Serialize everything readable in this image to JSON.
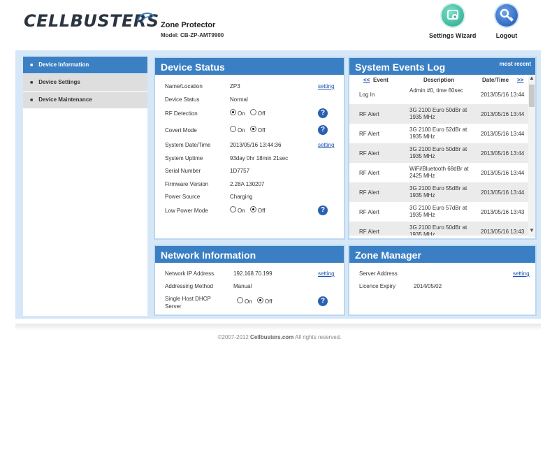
{
  "header": {
    "logo_text": "CELLBUSTERS",
    "product_name": "Zone Protector",
    "product_model": "Model: CB-ZP-AMT9900",
    "settings_wizard_label": "Settings Wizard",
    "logout_label": "Logout"
  },
  "sidebar": {
    "items": [
      {
        "label": "Device Information",
        "active": true
      },
      {
        "label": "Device Settings",
        "active": false
      },
      {
        "label": "Device Maintenance",
        "active": false
      }
    ]
  },
  "device_status": {
    "title": "Device Status",
    "setting_link": "setting",
    "name_label": "Name/Location",
    "name_value": "ZP3",
    "status_label": "Device Status",
    "status_value": "Normal",
    "rf_label": "RF Detection",
    "rf_value": "On",
    "covert_label": "Covert Mode",
    "covert_value": "Off",
    "datetime_label": "System Date/Time",
    "datetime_value": "2013/05/16 13:44:36",
    "uptime_label": "System Uptime",
    "uptime_value": "93day 0hr 18min 21sec",
    "serial_label": "Serial Number",
    "serial_value": "1D7757",
    "firmware_label": "Firmware Version",
    "firmware_value": "2.28A 130207",
    "power_label": "Power Source",
    "power_value": "Charging",
    "lowpower_label": "Low Power Mode",
    "lowpower_value": "Off",
    "on_label": "On",
    "off_label": "Off",
    "help_symbol": "?"
  },
  "events_log": {
    "title": "System Events Log",
    "most_recent": "most recent",
    "prev": "<<",
    "next": ">>",
    "col_event": "Event",
    "col_desc": "Description",
    "col_datetime": "Date/Time",
    "rows": [
      {
        "event": "Log In",
        "desc": "Admin #0, time 60sec",
        "datetime": "2013/05/16 13:44"
      },
      {
        "event": "RF Alert",
        "desc": "3G 2100 Euro 50dBr at 1935 MHz",
        "datetime": "2013/05/16 13:44"
      },
      {
        "event": "RF Alert",
        "desc": "3G 2100 Euro 52dBr at 1935 MHz",
        "datetime": "2013/05/16 13:44"
      },
      {
        "event": "RF Alert",
        "desc": "3G 2100 Euro 50dBr at 1935 MHz",
        "datetime": "2013/05/16 13:44"
      },
      {
        "event": "RF Alert",
        "desc": "WiFi/Bluetooth 68dBr at 2425 MHz",
        "datetime": "2013/05/16 13:44"
      },
      {
        "event": "RF Alert",
        "desc": "3G 2100 Euro 55dBr at 1935 MHz",
        "datetime": "2013/05/16 13:44"
      },
      {
        "event": "RF Alert",
        "desc": "3G 2100 Euro 57dBr at 1935 MHz",
        "datetime": "2013/05/16 13:43"
      },
      {
        "event": "RF Alert",
        "desc": "3G 2100 Euro 50dBr at 1935 MHz",
        "datetime": "2013/05/16 13:43"
      }
    ]
  },
  "network": {
    "title": "Network Information",
    "setting_link": "setting",
    "ip_label": "Network IP Address",
    "ip_value": "192.168.70.199",
    "addr_label": "Addressing Method",
    "addr_value": "Manual",
    "dhcp_label_1": "Single Host DHCP",
    "dhcp_label_2": "Server",
    "dhcp_value": "Off"
  },
  "zone_manager": {
    "title": "Zone Manager",
    "setting_link": "setting",
    "server_label": "Server Address",
    "licence_label": "Licence Expiry",
    "licence_value": "2014/05/02"
  },
  "footer": {
    "copyright_pre": "©2007-2012",
    "copyright_site": "Cellbusters.com",
    "copyright_post": "All rights reserved."
  },
  "colors": {
    "panel_header": "#3a7fc3",
    "frame_bg": "#d6e8f8",
    "sidebar_active": "#3c80c4"
  }
}
